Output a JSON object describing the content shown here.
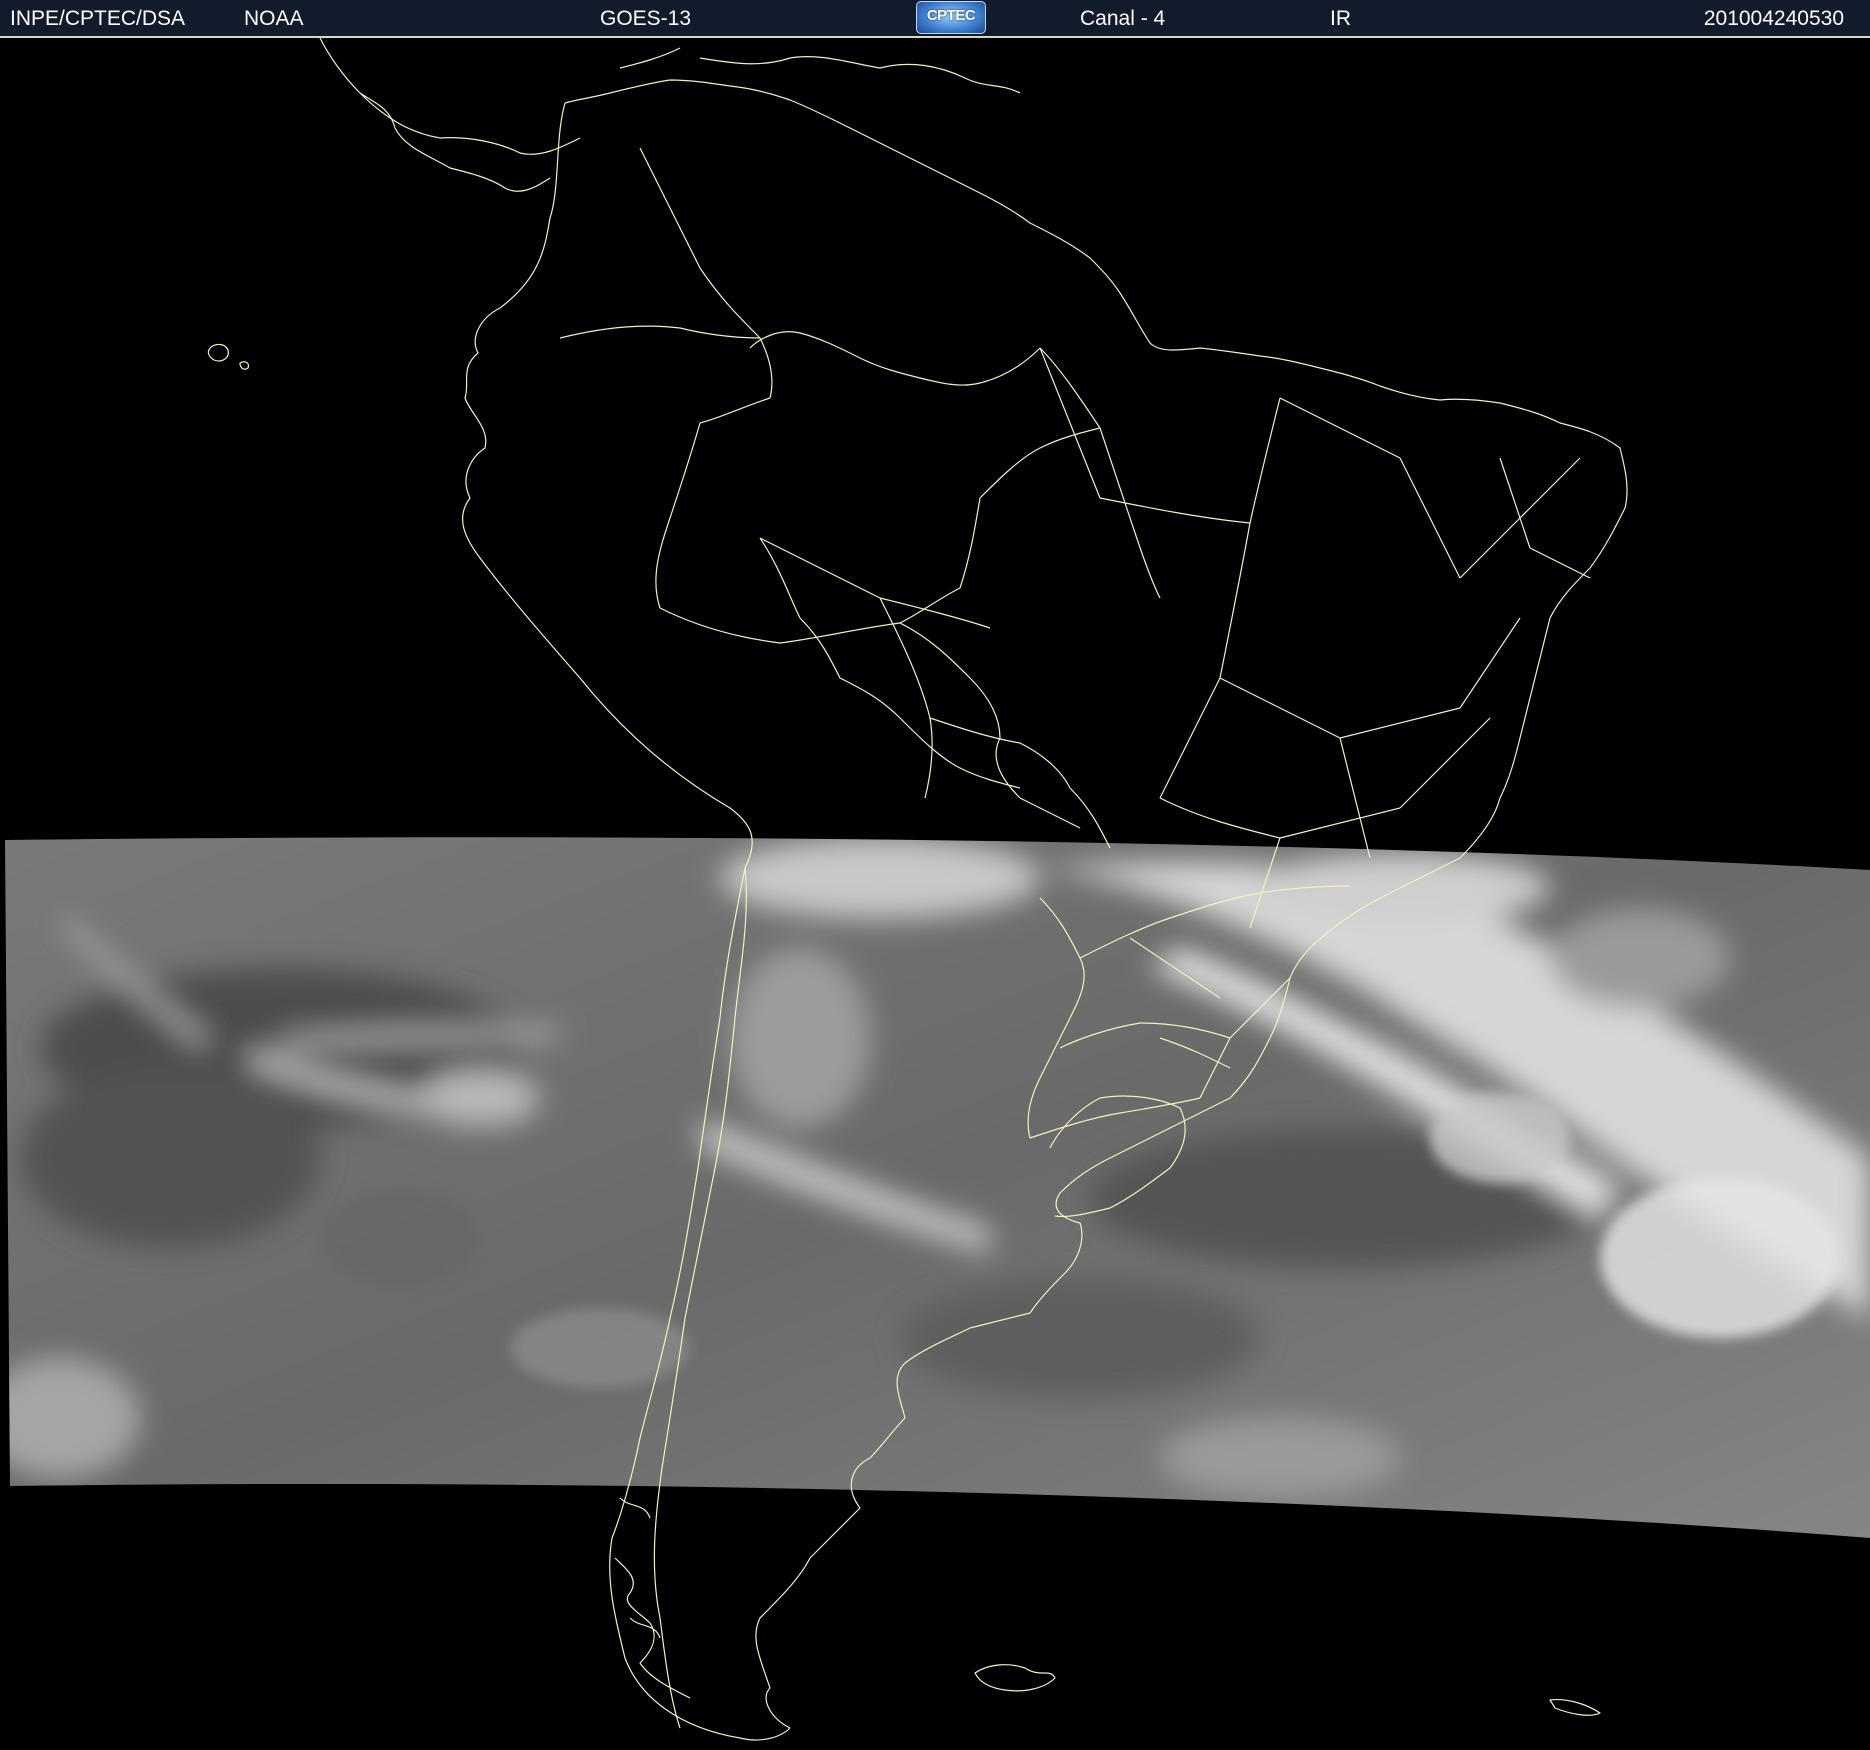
{
  "header": {
    "organization": "INPE/CPTEC/DSA",
    "agency": "NOAA",
    "satellite": "GOES-13",
    "logo_text": "CPTEC",
    "channel": "Canal - 4",
    "band": "IR",
    "timestamp": "201004240530"
  },
  "map": {
    "region": "South America",
    "imagery": "infrared",
    "background_color": "#000000",
    "coastline_color": "#f4f0c0",
    "cloud_colors": [
      "#5a5a5a",
      "#8c8c8c",
      "#d8d8d8"
    ]
  }
}
